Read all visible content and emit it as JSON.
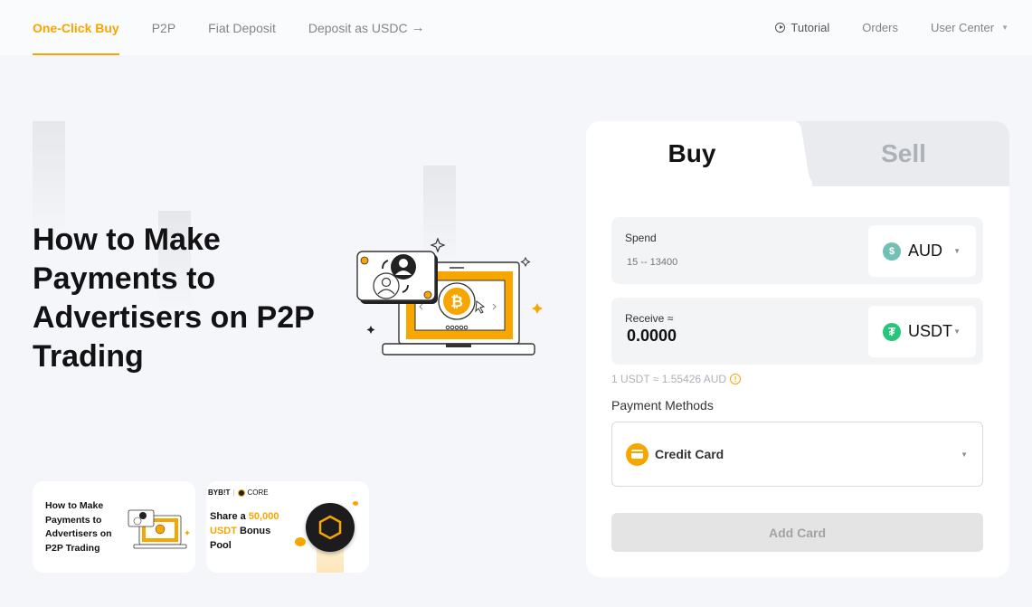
{
  "nav": {
    "tabs": [
      {
        "label": "One-Click Buy",
        "active": true
      },
      {
        "label": "P2P",
        "active": false
      },
      {
        "label": "Fiat Deposit",
        "active": false
      },
      {
        "label": "Deposit as USDC",
        "active": false,
        "icon": "arrow-right-icon"
      }
    ],
    "arrow_glyph": "→",
    "right": {
      "tutorial": "Tutorial",
      "orders": "Orders",
      "user_center": "User Center",
      "caret_glyph": "▼"
    }
  },
  "hero": {
    "title": "How to Make Payments to Advertisers on P2P Trading"
  },
  "promos": [
    {
      "title": "How to Make Payments to Advertisers on P2P Trading"
    },
    {
      "brand_left": "BYB!T",
      "brand_sep": "|",
      "brand_right": "CORE",
      "text_1": "Share a ",
      "highlight_1": "50,000",
      "highlight_2": "USDT",
      "text_2": " Bonus",
      "text_3": "Pool"
    }
  ],
  "trade": {
    "tabs": {
      "buy": "Buy",
      "sell": "Sell",
      "active": "buy"
    },
    "spend": {
      "label": "Spend",
      "placeholder": "15 -- 13400",
      "currency": "AUD",
      "currency_icon": "$",
      "currency_color": "#72bfb4"
    },
    "receive": {
      "label": "Receive ≈",
      "value": "0.0000",
      "currency": "USDT",
      "currency_icon": "₮",
      "currency_color": "#26c77a"
    },
    "caret_glyph": "▼",
    "rate": "1 USDT ≈ 1.55426 AUD",
    "rate_info_glyph": "!",
    "payment_label": "Payment Methods",
    "payment_method": "Credit Card",
    "add_button": "Add Card"
  },
  "colors": {
    "accent": "#f7a600",
    "background": "#f5f6fa",
    "disabled_button": "#e4e4e4"
  }
}
